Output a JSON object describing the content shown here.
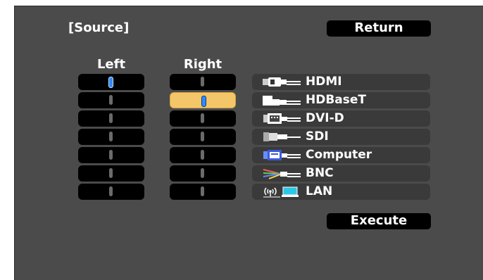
{
  "header": {
    "title": "[Source]",
    "return_label": "Return"
  },
  "columns": {
    "left_label": "Left",
    "right_label": "Right"
  },
  "left_slots": [
    {
      "state": "active"
    },
    {
      "state": "idle"
    },
    {
      "state": "idle"
    },
    {
      "state": "idle"
    },
    {
      "state": "idle"
    },
    {
      "state": "idle"
    },
    {
      "state": "idle"
    }
  ],
  "right_slots": [
    {
      "state": "idle"
    },
    {
      "state": "selected"
    },
    {
      "state": "idle"
    },
    {
      "state": "idle"
    },
    {
      "state": "idle"
    },
    {
      "state": "idle"
    },
    {
      "state": "idle"
    }
  ],
  "sources": [
    {
      "label": "HDMI",
      "icon": "hdmi-icon"
    },
    {
      "label": "HDBaseT",
      "icon": "hdbaset-icon"
    },
    {
      "label": "DVI-D",
      "icon": "dvi-d-icon"
    },
    {
      "label": "SDI",
      "icon": "sdi-icon"
    },
    {
      "label": "Computer",
      "icon": "computer-icon"
    },
    {
      "label": "BNC",
      "icon": "bnc-icon"
    },
    {
      "label": "LAN",
      "icon": "lan-icon"
    }
  ],
  "footer": {
    "execute_label": "Execute"
  },
  "colors": {
    "background": "#4b4b4b",
    "slot": "#000000",
    "selected": "#f4c66a",
    "indicator": "#2f8cff"
  }
}
